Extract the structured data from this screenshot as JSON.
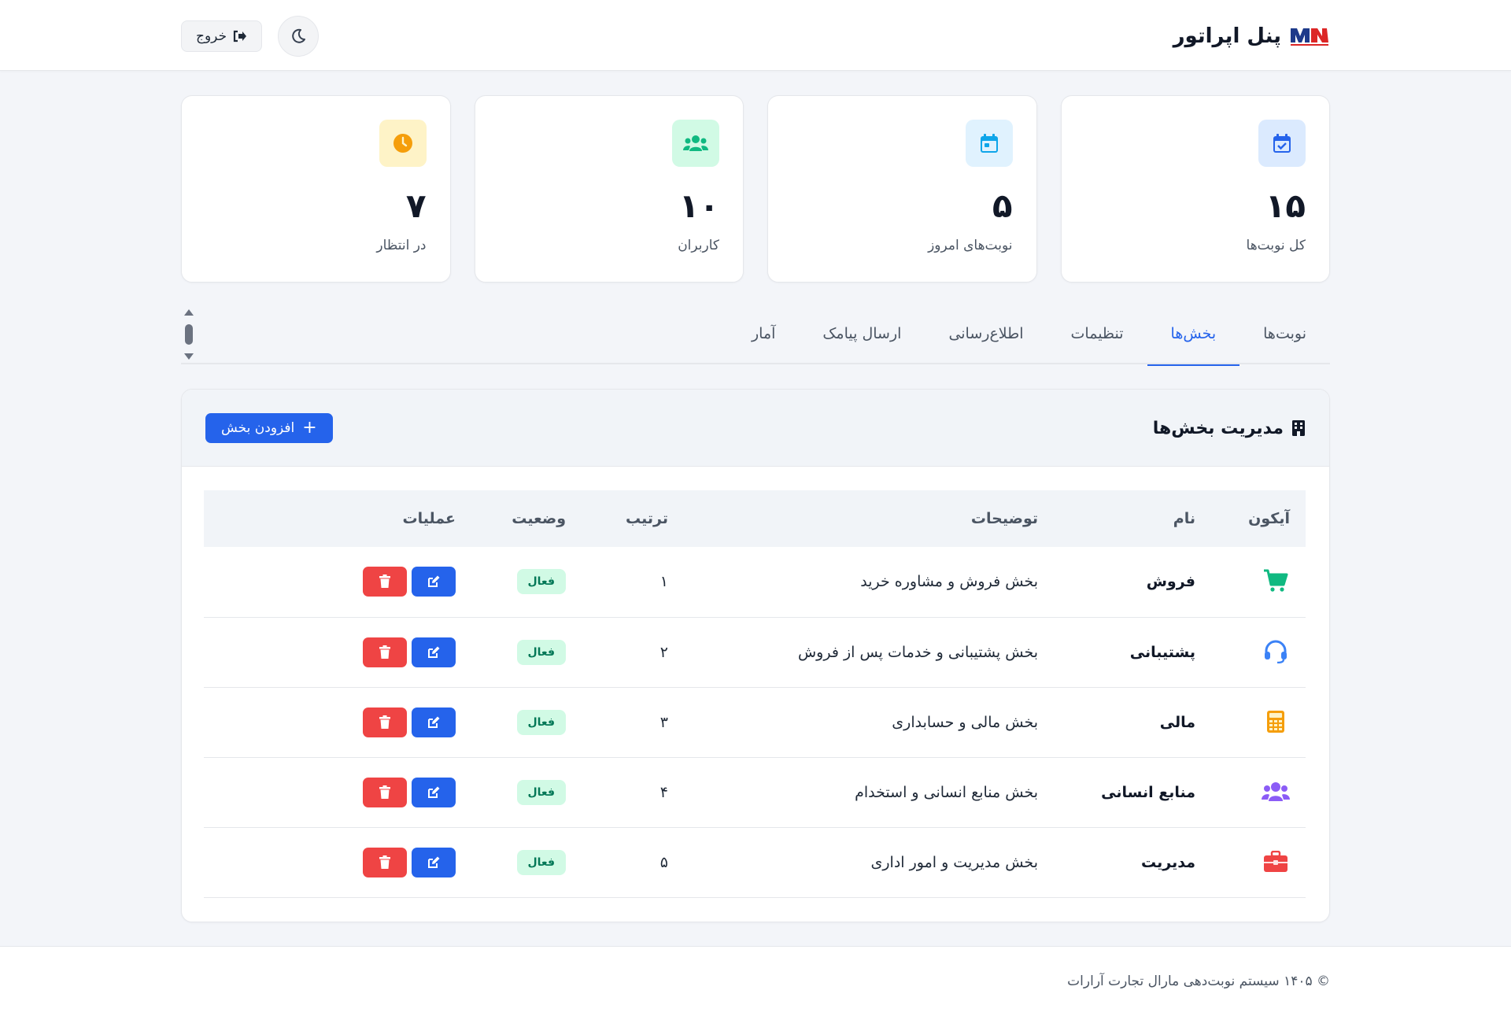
{
  "header": {
    "title": "پنل اپراتور",
    "logout_label": "خروج",
    "theme_icon": "moon-icon",
    "logout_icon": "sign-out-icon"
  },
  "stats": [
    {
      "value": "۱۵",
      "label": "کل نوبت‌ها",
      "icon": "calendar-check-icon",
      "color": "#2563eb",
      "bg": "#dbeafe"
    },
    {
      "value": "۵",
      "label": "نوبت‌های امروز",
      "icon": "calendar-day-icon",
      "color": "#0ea5e9",
      "bg": "#e0f2fe"
    },
    {
      "value": "۱۰",
      "label": "کاربران",
      "icon": "users-icon",
      "color": "#10b981",
      "bg": "#d1fae5"
    },
    {
      "value": "۷",
      "label": "در انتظار",
      "icon": "clock-icon",
      "color": "#f59e0b",
      "bg": "#fef3c7"
    }
  ],
  "tabs": [
    {
      "label": "نوبت‌ها",
      "active": false
    },
    {
      "label": "بخش‌ها",
      "active": true
    },
    {
      "label": "تنظیمات",
      "active": false
    },
    {
      "label": "اطلاع‌رسانی",
      "active": false
    },
    {
      "label": "ارسال پیامک",
      "active": false
    },
    {
      "label": "آمار",
      "active": false
    }
  ],
  "panel": {
    "title": "مدیریت بخش‌ها",
    "title_icon": "building-icon",
    "add_label": "افزودن بخش"
  },
  "table": {
    "headers": {
      "icon": "آیکون",
      "name": "نام",
      "description": "توضیحات",
      "order": "ترتیب",
      "status": "وضعیت",
      "actions": "عملیات"
    },
    "rows": [
      {
        "icon": "shopping-cart-icon",
        "icon_color": "#10b981",
        "name": "فروش",
        "description": "بخش فروش و مشاوره خرید",
        "order": "۱",
        "status": "فعال"
      },
      {
        "icon": "headset-icon",
        "icon_color": "#3b82f6",
        "name": "پشتیبانی",
        "description": "بخش پشتیبانی و خدمات پس از فروش",
        "order": "۲",
        "status": "فعال"
      },
      {
        "icon": "calculator-icon",
        "icon_color": "#f59e0b",
        "name": "مالی",
        "description": "بخش مالی و حسابداری",
        "order": "۳",
        "status": "فعال"
      },
      {
        "icon": "users-icon",
        "icon_color": "#8b5cf6",
        "name": "منابع انسانی",
        "description": "بخش منابع انسانی و استخدام",
        "order": "۴",
        "status": "فعال"
      },
      {
        "icon": "briefcase-icon",
        "icon_color": "#ef4444",
        "name": "مدیریت",
        "description": "بخش مدیریت و امور اداری",
        "order": "۵",
        "status": "فعال"
      }
    ]
  },
  "footer": {
    "text": "© ۱۴۰۵ سیستم نوبت‌دهی مارال تجارت آرارات"
  },
  "colors": {
    "primary": "#2563eb",
    "danger": "#ef4444",
    "success_bg": "#d1fae5",
    "success_text": "#047857"
  }
}
